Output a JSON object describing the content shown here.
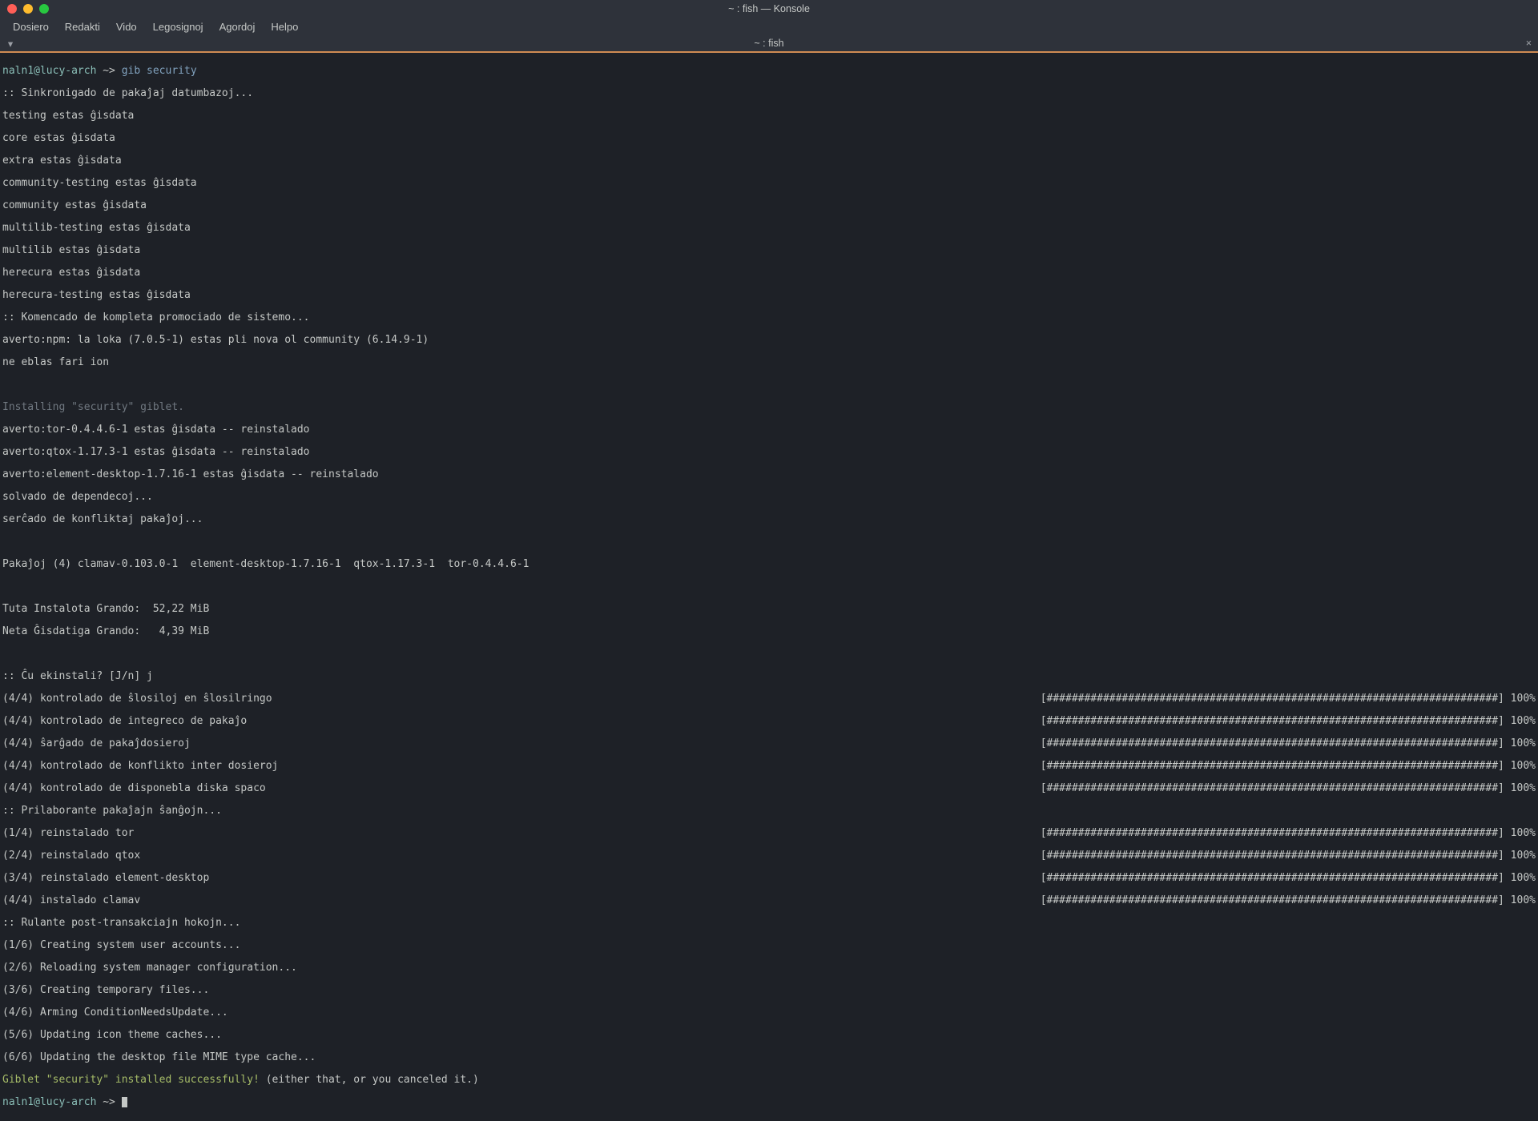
{
  "window": {
    "title": "~ : fish — Konsole"
  },
  "menu": {
    "items": [
      "Dosiero",
      "Redakti",
      "Vido",
      "Legosignoj",
      "Agordoj",
      "Helpo"
    ]
  },
  "tab": {
    "label": "~ : fish",
    "new_symbol": "▾",
    "close_symbol": "×"
  },
  "prompt": {
    "userhost": "naln1@lucy-arch ",
    "dir": "~",
    "arrow": "~> ",
    "command_kw": "gib",
    "command_arg": " security"
  },
  "lines": {
    "l01": ":: Sinkronigado de pakaĵaj datumbazoj...",
    "l02": "testing estas ĝisdata",
    "l03": "core estas ĝisdata",
    "l04": "extra estas ĝisdata",
    "l05": "community-testing estas ĝisdata",
    "l06": "community estas ĝisdata",
    "l07": "multilib-testing estas ĝisdata",
    "l08": "multilib estas ĝisdata",
    "l09": "herecura estas ĝisdata",
    "l10": "herecura-testing estas ĝisdata",
    "l11": ":: Komencado de kompleta promociado de sistemo...",
    "l12": "averto:npm: la loka (7.0.5-1) estas pli nova ol community (6.14.9-1)",
    "l13": "ne eblas fari ion",
    "blank": " ",
    "install_msg": "Installing \"security\" giblet.",
    "l14": "averto:tor-0.4.4.6-1 estas ĝisdata -- reinstalado",
    "l15": "averto:qtox-1.17.3-1 estas ĝisdata -- reinstalado",
    "l16": "averto:element-desktop-1.7.16-1 estas ĝisdata -- reinstalado",
    "l17": "solvado de dependecoj...",
    "l18": "serĉado de konfliktaj pakaĵoj...",
    "l19": "Pakaĵoj (4) clamav-0.103.0-1  element-desktop-1.7.16-1  qtox-1.17.3-1  tor-0.4.4.6-1",
    "l20": "Tuta Instalota Grando:  52,22 MiB",
    "l21": "Neta Ĝisdatiga Grando:   4,39 MiB",
    "l22": ":: Ĉu ekinstali? [J/n] j",
    "p1l": "(4/4) kontrolado de ŝlosiloj en ŝlosilringo",
    "p2l": "(4/4) kontrolado de integreco de pakaĵo",
    "p3l": "(4/4) ŝarĝado de pakaĵdosieroj",
    "p4l": "(4/4) kontrolado de konflikto inter dosieroj",
    "p5l": "(4/4) kontrolado de disponebla diska spaco",
    "l23": ":: Prilaborante pakaĵajn ŝanĝojn...",
    "p6l": "(1/4) reinstalado tor",
    "p7l": "(2/4) reinstalado qtox",
    "p8l": "(3/4) reinstalado element-desktop",
    "p9l": "(4/4) instalado clamav",
    "l24": ":: Rulante post-transakciajn hokojn...",
    "l25": "(1/6) Creating system user accounts...",
    "l26": "(2/6) Reloading system manager configuration...",
    "l27": "(3/6) Creating temporary files...",
    "l28": "(4/6) Arming ConditionNeedsUpdate...",
    "l29": "(5/6) Updating icon theme caches...",
    "l30": "(6/6) Updating the desktop file MIME type cache...",
    "success": "Giblet \"security\" installed successfully!",
    "success_tail": " (either that, or you canceled it.)",
    "bar": "[########################################################################] 100%"
  }
}
